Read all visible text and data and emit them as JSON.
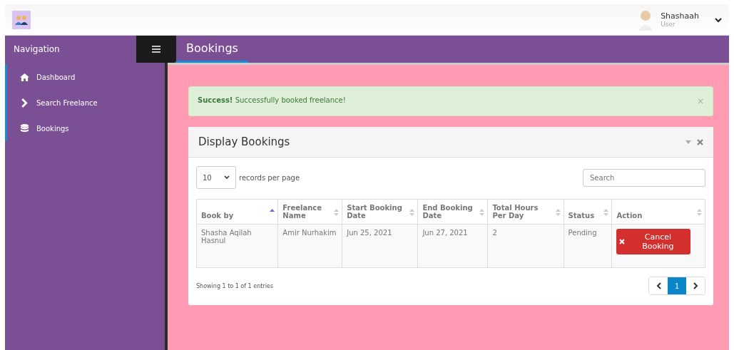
{
  "user": {
    "name": "Shashaah",
    "role": "User"
  },
  "sidebar": {
    "title": "Navigation",
    "items": [
      {
        "label": "Dashboard",
        "kind": "home"
      },
      {
        "label": "Search Freelance",
        "kind": "link"
      },
      {
        "label": "Bookings",
        "kind": "data"
      }
    ]
  },
  "page_title": "Bookings",
  "alert": {
    "title": "Success!",
    "message": "Successfully booked freelance!",
    "close": "×"
  },
  "panel": {
    "title": "Display Bookings",
    "page_size": "10",
    "page_size_label": "records per page",
    "search_placeholder": "Search",
    "table": {
      "columns": [
        {
          "label": "Book by",
          "sorted": true
        },
        {
          "label": "Freelance Name",
          "sorted": false
        },
        {
          "label": "Start Booking Date",
          "sorted": false
        },
        {
          "label": "End Booking Date",
          "sorted": false
        },
        {
          "label": "Total Hours Per Day",
          "sorted": false
        },
        {
          "label": "Status",
          "sorted": false
        },
        {
          "label": "Action",
          "sorted": false
        }
      ],
      "rows": [
        {
          "book_by": "Shasha Aqilah Hasnul",
          "freelance_name": "Amir Nurhakim",
          "start": "Jun 25, 2021",
          "end": "Jun 27, 2021",
          "hours": "2",
          "status": "Pending",
          "action": "Cancel Booking"
        }
      ]
    },
    "info": "Showing 1 to 1 of 1 entries",
    "pages": [
      {
        "label": "1",
        "selected": true
      }
    ]
  }
}
